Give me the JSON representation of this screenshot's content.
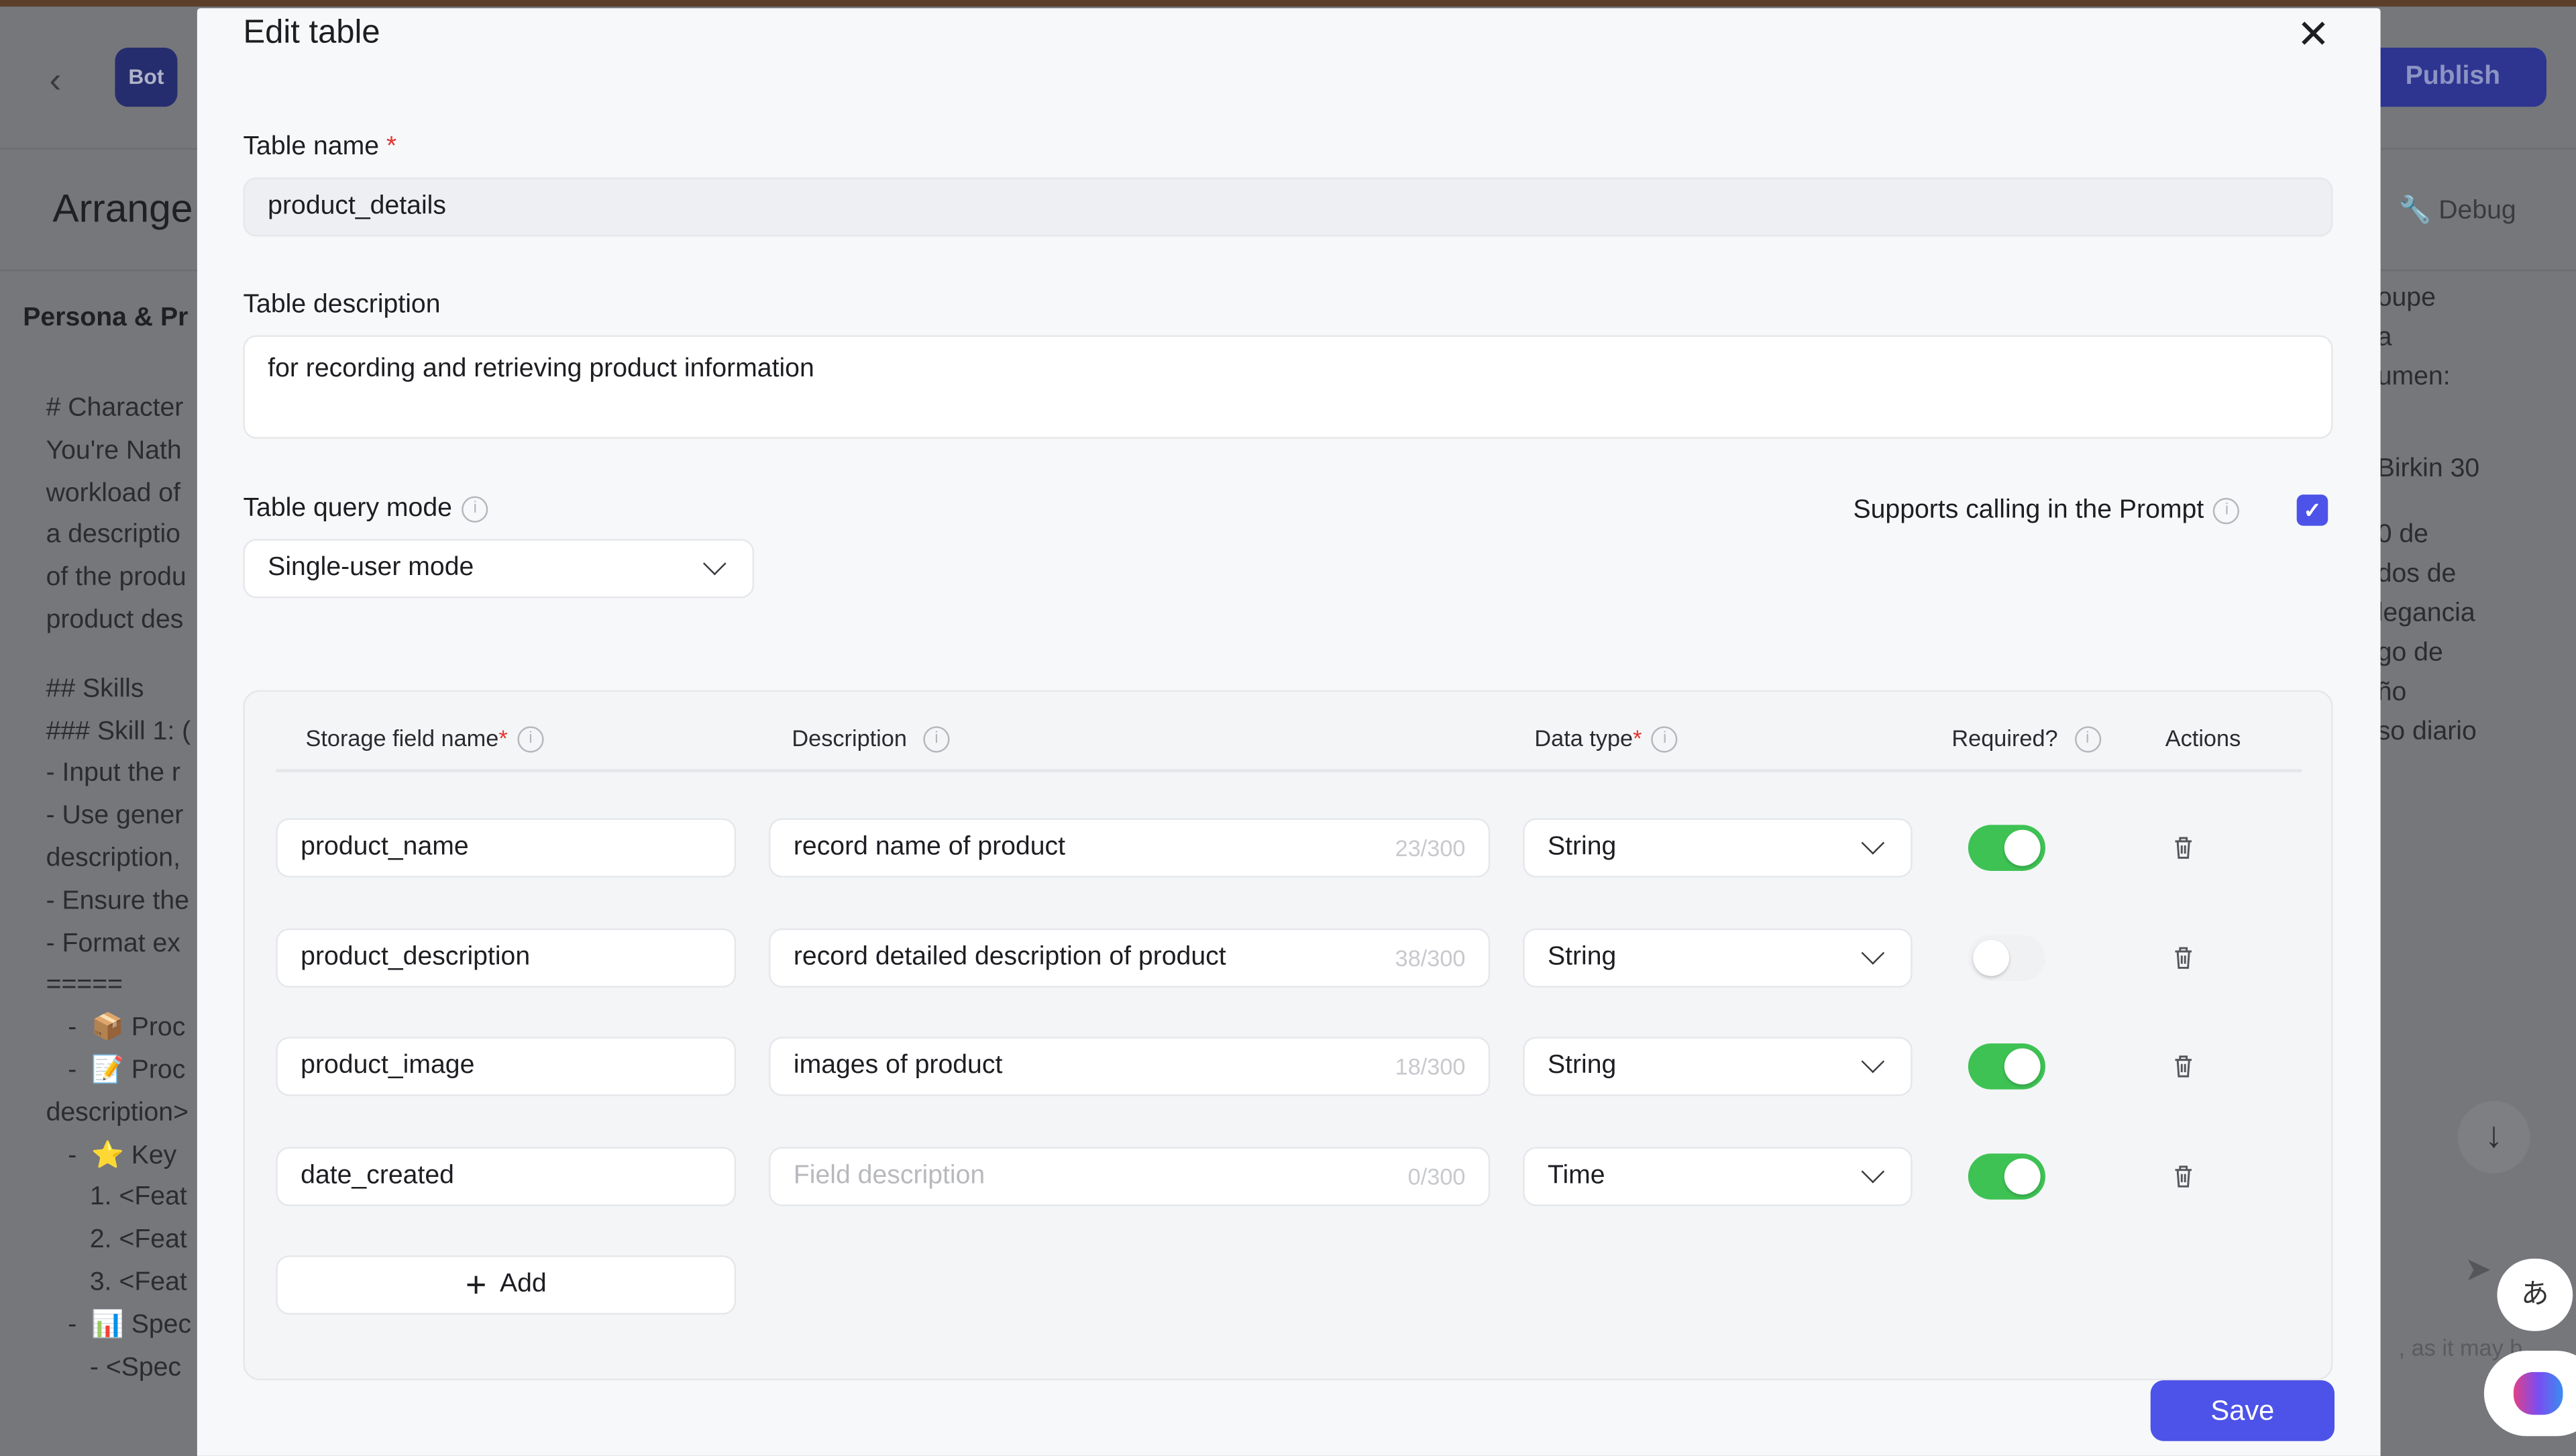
{
  "background": {
    "bot_badge": "Bot",
    "publish_label": "Publish",
    "arrange_title": "Arrange",
    "debug_label": "Debug",
    "persona_label": "Persona & Pr",
    "left_lines": [
      "# Character",
      "You're Nath",
      "workload of",
      "a descriptio",
      "of the produ",
      "product des",
      "",
      "## Skills",
      "### Skill 1: (",
      "- Input the r",
      "- Use gener",
      "description,",
      "- Ensure the",
      "- Format ex",
      "=====",
      "   -  📦 Proc",
      "   -  📝 Proc",
      "description>",
      "   -  ⭐ Key",
      "      1. <Feat",
      "      2. <Feat",
      "      3. <Feat",
      "   -  📊 Spec",
      "      - <Spec"
    ],
    "right_lines": [
      "oupe",
      "a",
      "umen:",
      "",
      "",
      "Birkin 30",
      "",
      "0 de",
      "dos de",
      "legancia",
      "go de",
      "ño",
      "so diario"
    ],
    "footer_hint": ", as it may b"
  },
  "modal": {
    "title": "Edit table",
    "table_name_label": "Table name",
    "table_name_value": "product_details",
    "table_description_label": "Table description",
    "table_description_value": "for recording and retrieving product information",
    "query_mode_label": "Table query mode",
    "query_mode_value": "Single-user mode",
    "supports_prompt_label": "Supports calling in the Prompt",
    "supports_prompt_checked": true,
    "columns": {
      "field": "Storage field name",
      "description": "Description",
      "type": "Data type",
      "required": "Required?",
      "actions": "Actions"
    },
    "required_mark": "*",
    "rows": [
      {
        "name": "product_name",
        "description": "record name of product",
        "count": "23/300",
        "type": "String",
        "required": true
      },
      {
        "name": "product_description",
        "description": "record detailed description of product",
        "count": "38/300",
        "type": "String",
        "required": false
      },
      {
        "name": "product_image",
        "description": " images of product",
        "count": "18/300",
        "type": "String",
        "required": true
      },
      {
        "name": "date_created",
        "description": "",
        "description_placeholder": "Field description",
        "count": "0/300",
        "type": "Time",
        "required": true
      }
    ],
    "add_label": "Add",
    "save_label": "Save"
  },
  "colors": {
    "accent": "#4d53e8",
    "toggle_on": "#3ec254",
    "publish": "#2d3590"
  }
}
